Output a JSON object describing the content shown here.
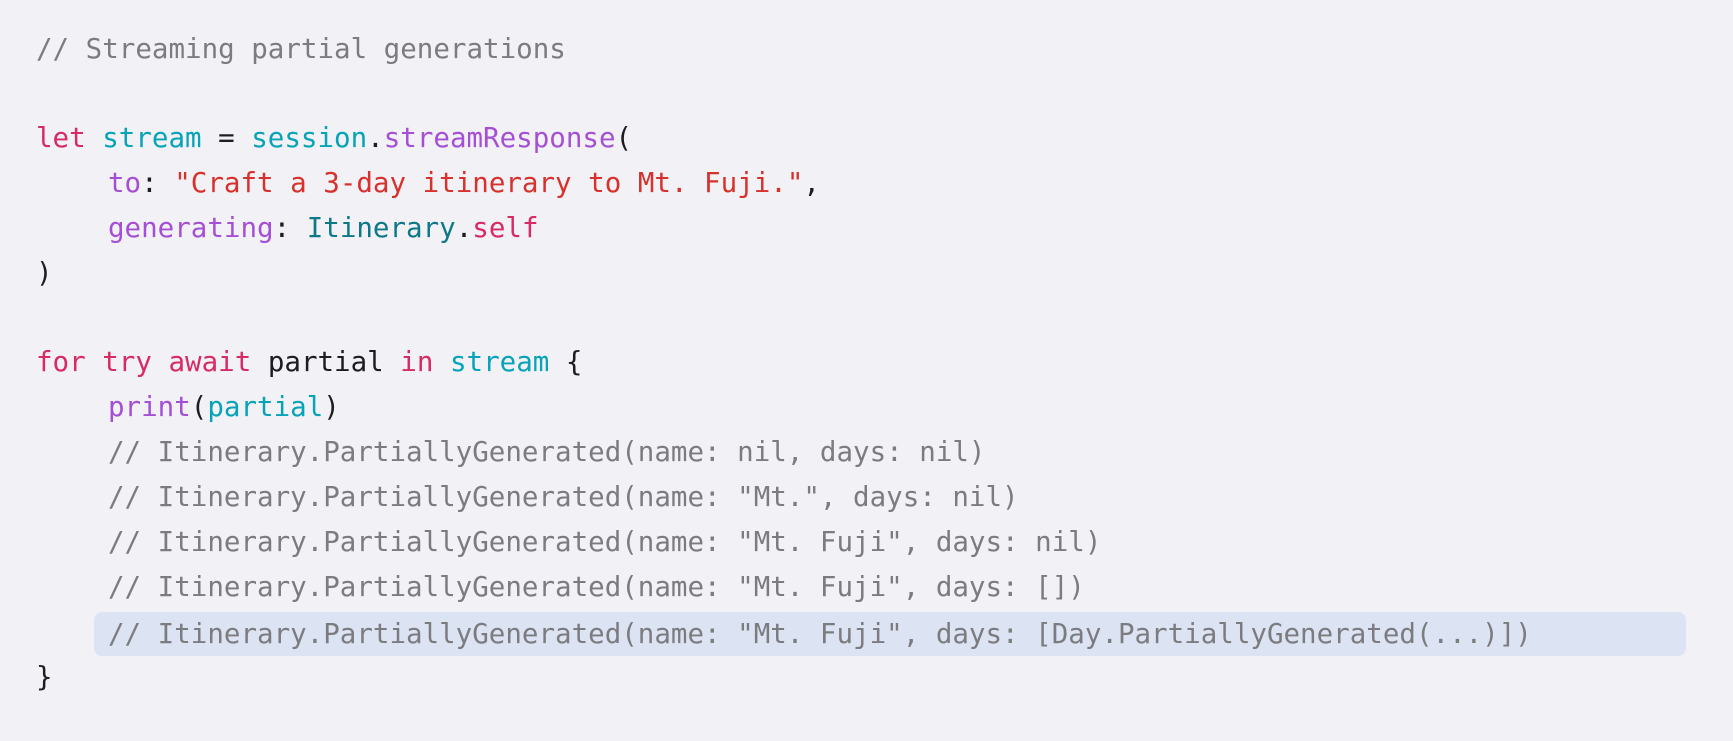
{
  "colors": {
    "background": "#f2f2f6",
    "comment": "#7c7c80",
    "keyword": "#d72b63",
    "variable": "#07a3b8",
    "function": "#a550d4",
    "string": "#d7312e",
    "type": "#0e7888",
    "plain": "#1d1d1f",
    "highlight": "#dce4f3"
  },
  "code": {
    "comment_header": "// Streaming partial generations",
    "line_let": {
      "kw_let": "let",
      "var_stream": "stream",
      "eq": " = ",
      "obj_session": "session",
      "dot": ".",
      "method_streamResponse": "streamResponse",
      "open_paren": "("
    },
    "line_to": {
      "label_to": "to",
      "colon": ": ",
      "prompt_string": "\"Craft a 3-day itinerary to Mt. Fuji.\"",
      "comma": ","
    },
    "line_generating": {
      "label_generating": "generating",
      "colon": ": ",
      "type_itinerary": "Itinerary",
      "dot": ".",
      "kw_self": "self"
    },
    "close_paren": ")",
    "line_for": {
      "kw_for": "for",
      "kw_try": "try",
      "kw_await": "await",
      "var_partial": "partial",
      "kw_in": "in",
      "var_stream": "stream",
      "open_brace": "{"
    },
    "line_print": {
      "fn_print": "print",
      "open_paren": "(",
      "var_partial": "partial",
      "close_paren": ")"
    },
    "output_comments": [
      "// Itinerary.PartiallyGenerated(name: nil, days: nil)",
      "// Itinerary.PartiallyGenerated(name: \"Mt.\", days: nil)",
      "// Itinerary.PartiallyGenerated(name: \"Mt. Fuji\", days: nil)",
      "// Itinerary.PartiallyGenerated(name: \"Mt. Fuji\", days: [])",
      "// Itinerary.PartiallyGenerated(name: \"Mt. Fuji\", days: [Day.PartiallyGenerated(...)])"
    ],
    "close_brace": "}"
  }
}
